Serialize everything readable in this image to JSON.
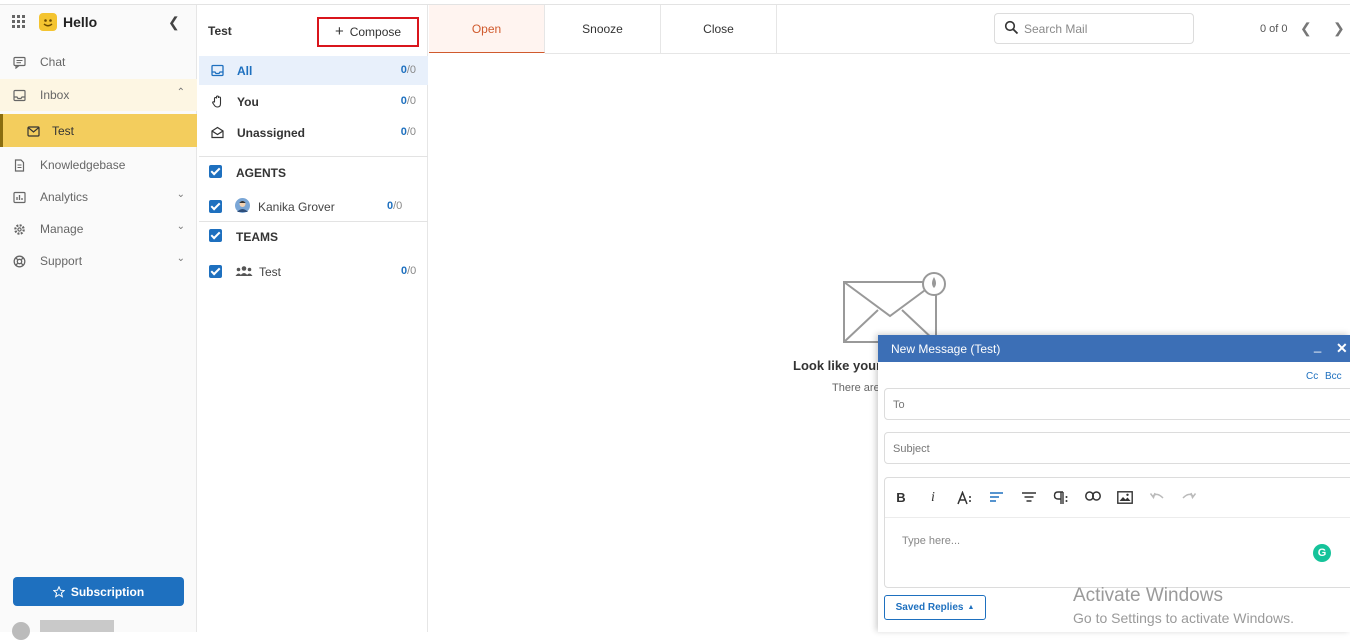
{
  "app": {
    "name": "Hello"
  },
  "sidebar": {
    "items": [
      {
        "key": "chat",
        "label": "Chat"
      },
      {
        "key": "inbox",
        "label": "Inbox"
      },
      {
        "key": "test",
        "label": "Test"
      },
      {
        "key": "knowledgebase",
        "label": "Knowledgebase"
      },
      {
        "key": "analytics",
        "label": "Analytics"
      },
      {
        "key": "manage",
        "label": "Manage"
      },
      {
        "key": "support",
        "label": "Support"
      }
    ],
    "subscription_label": "Subscription"
  },
  "folders": {
    "title": "Test",
    "compose_label": "Compose",
    "items": [
      {
        "label": "All",
        "count": "0",
        "total": "/0"
      },
      {
        "label": "You",
        "count": "0",
        "total": "/0"
      },
      {
        "label": "Unassigned",
        "count": "0",
        "total": "/0"
      }
    ],
    "agents_label": "AGENTS",
    "agents": [
      {
        "name": "Kanika Grover",
        "count": "0",
        "total": "/0"
      }
    ],
    "teams_label": "TEAMS",
    "teams": [
      {
        "name": "Test",
        "count": "0",
        "total": "/0"
      }
    ]
  },
  "main": {
    "tabs": [
      {
        "label": "Open"
      },
      {
        "label": "Snooze"
      },
      {
        "label": "Close"
      }
    ],
    "search_placeholder": "Search Mail",
    "pager": "0 of 0",
    "empty_title": "Look like your",
    "empty_sub": "There are"
  },
  "compose": {
    "title": "New Message (Test)",
    "min_label": "_",
    "close_label": "✕",
    "cc_label": "Cc",
    "bcc_label": "Bcc",
    "to_placeholder": "To",
    "subject_placeholder": "Subject",
    "body_placeholder": "Type here...",
    "saved_replies_label": "Saved Replies",
    "toolbar": {
      "bold": "B",
      "italic": "i"
    }
  },
  "watermark": {
    "title": "Activate Windows",
    "subtitle": "Go to Settings to activate Windows."
  },
  "colors": {
    "accent": "#1e70bf",
    "active_nav": "#f3cd5d",
    "open_tab": "#d05a2d",
    "compose_outline": "#d9151c"
  }
}
